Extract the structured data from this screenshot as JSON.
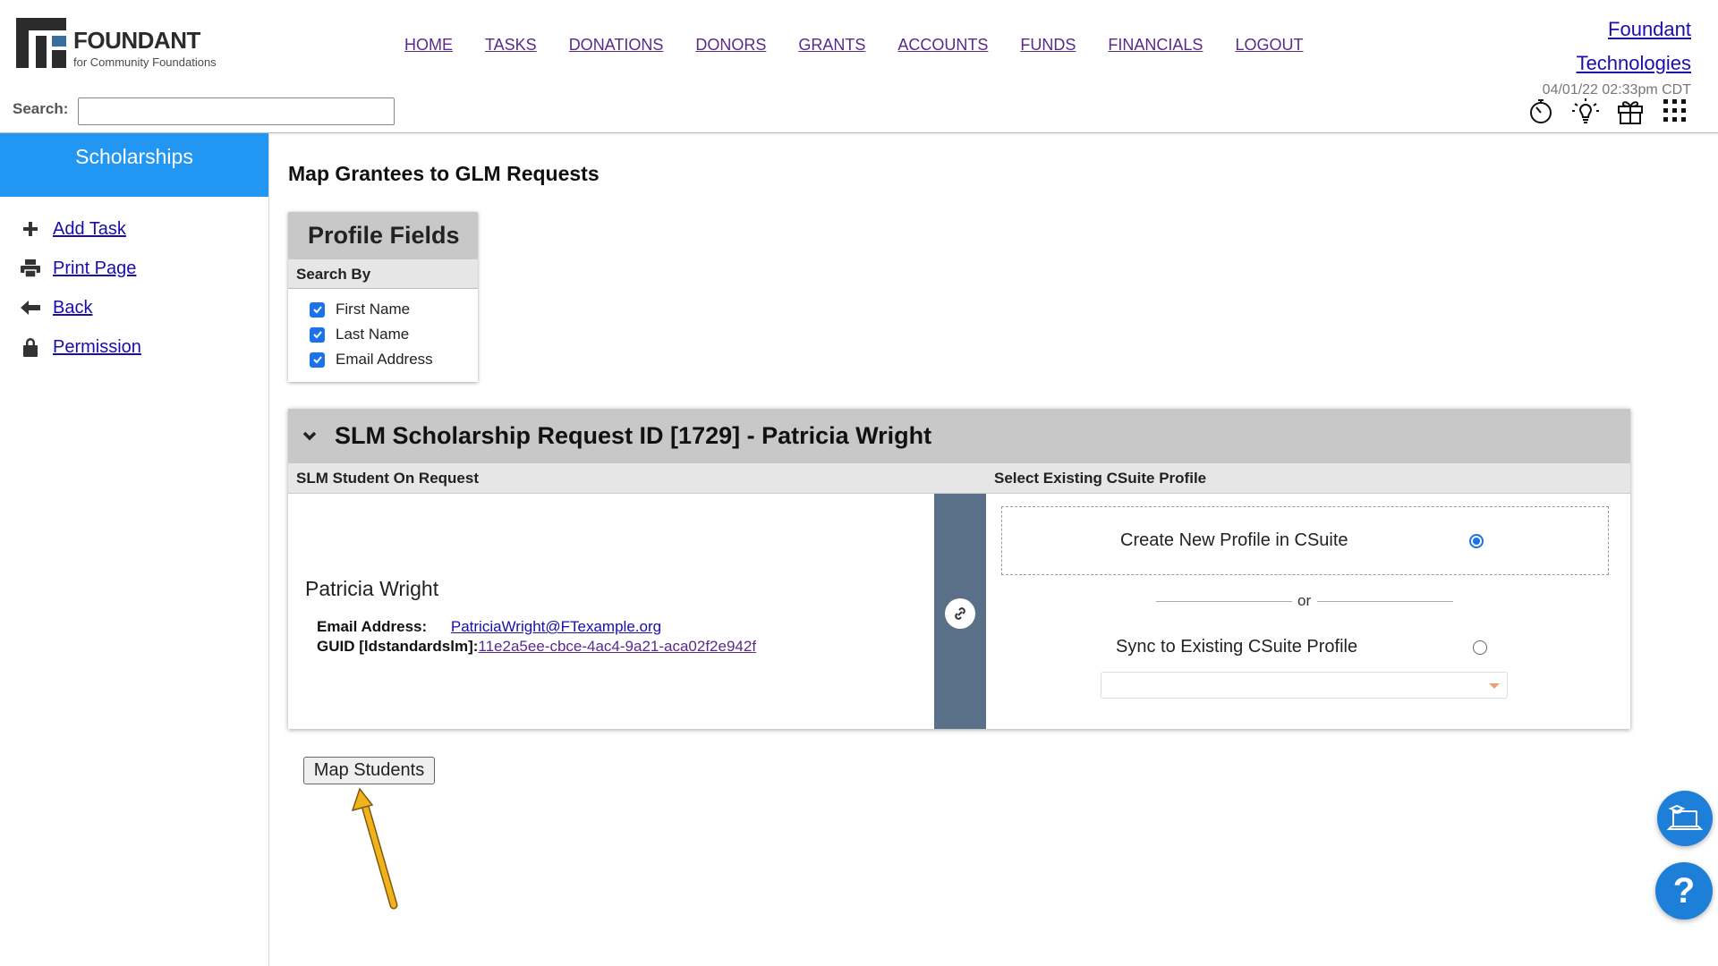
{
  "brand": {
    "name": "FOUNDANT",
    "tagline": "for Community Foundations"
  },
  "nav": [
    "HOME",
    "TASKS",
    "DONATIONS",
    "DONORS",
    "GRANTS",
    "ACCOUNTS",
    "FUNDS",
    "FINANCIALS",
    "LOGOUT"
  ],
  "company": {
    "line1": "Foundant",
    "line2": "Technologies",
    "timestamp": "04/01/22 02:33pm CDT"
  },
  "search": {
    "label": "Search:",
    "value": ""
  },
  "utility_icons": [
    "stopwatch-icon",
    "lightbulb-icon",
    "gift-icon",
    "app-grid-icon"
  ],
  "sidebar": {
    "title": "Scholarships",
    "items": [
      {
        "label": "Add Task",
        "icon": "plus-icon"
      },
      {
        "label": "Print Page",
        "icon": "printer-icon"
      },
      {
        "label": "Back",
        "icon": "arrow-left-icon"
      },
      {
        "label": "Permission",
        "icon": "lock-icon"
      }
    ]
  },
  "main": {
    "title": "Map Grantees to GLM Requests",
    "profile_fields": {
      "heading": "Profile Fields",
      "search_by": "Search By",
      "fields": [
        {
          "label": "First Name",
          "checked": true
        },
        {
          "label": "Last Name",
          "checked": true
        },
        {
          "label": "Email Address",
          "checked": true
        }
      ]
    },
    "request": {
      "title": "SLM Scholarship Request ID [1729] - Patricia Wright",
      "left_header": "SLM Student On Request",
      "right_header": "Select Existing CSuite Profile",
      "student_name": "Patricia Wright",
      "email_label": "Email Address:",
      "email_value": "PatriciaWright@FTexample.org",
      "guid_label": "GUID [ldstandardslm]:",
      "guid_value": "11e2a5ee-cbce-4ac4-9a21-aca02f2e942f",
      "option_new": "Create New Profile in CSuite",
      "option_new_selected": true,
      "or_text": "or",
      "option_sync": "Sync to Existing CSuite Profile",
      "option_sync_selected": false,
      "profile_select_value": ""
    },
    "map_button": "Map Students"
  },
  "colors": {
    "sidebar_accent": "#2196f3",
    "link": "#1a0dab",
    "nav_link": "#5a2a8a",
    "link_strip": "#5a7088",
    "annotation_arrow": "#f2b21c",
    "fab": "#1e7fd8"
  }
}
